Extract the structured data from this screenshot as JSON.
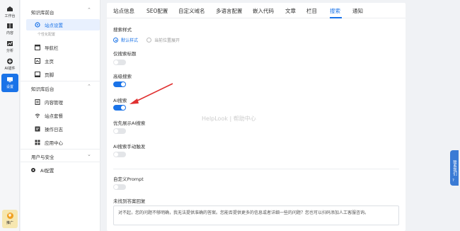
{
  "rail": {
    "items": [
      {
        "label": "工作台",
        "icon": "home-icon"
      },
      {
        "label": "内容",
        "icon": "book-icon"
      },
      {
        "label": "分析",
        "icon": "chart-icon"
      },
      {
        "label": "AI插件",
        "icon": "plugin-icon"
      },
      {
        "label": "设置",
        "icon": "settings-icon"
      }
    ],
    "promo_label": "推广",
    "promo_coin": "¥"
  },
  "sidebar": {
    "group1": "知识库前台",
    "site_settings": "站点设置",
    "personalize_note": "个性化配置",
    "nav_bar": "导航栏",
    "homepage": "主页",
    "footer": "页脚",
    "group2": "知识库后台",
    "content_mgmt": "内容管理",
    "site_analytics": "站点套餐",
    "op_log": "操作日志",
    "app_center": "应用中心",
    "group3": "用户与安全",
    "ai_config": "AI配置"
  },
  "tabs": [
    "站点信息",
    "SEO配置",
    "自定义域名",
    "多语言配置",
    "嵌入代码",
    "文章",
    "栏目",
    "搜索",
    "通知"
  ],
  "active_tab": 7,
  "form": {
    "search_style_label": "搜索样式",
    "radio_default": "默认样式",
    "radio_current": "当前位置展开",
    "title_only_label": "仅搜索标题",
    "advanced_label": "高级搜索",
    "ai_search_label": "AI搜索",
    "prefer_ai_label": "优先展示AI搜索",
    "manual_trigger_label": "AI搜索手动触发",
    "custom_prompt_label": "自定义Prompt",
    "no_answer_label": "未找到答案回复",
    "no_answer_value": "对不起，您的问题不够明确，我无法提供准确的答案。您能否提供更多的信息或者详细一些的问题？您也可以扫码添加人工客服咨询。"
  },
  "watermark": "HelpLook  |  帮助中心",
  "float": {
    "contact": "联系我们",
    "help": "?"
  },
  "colors": {
    "accent": "#1a73e8",
    "arrow": "#e03030"
  }
}
